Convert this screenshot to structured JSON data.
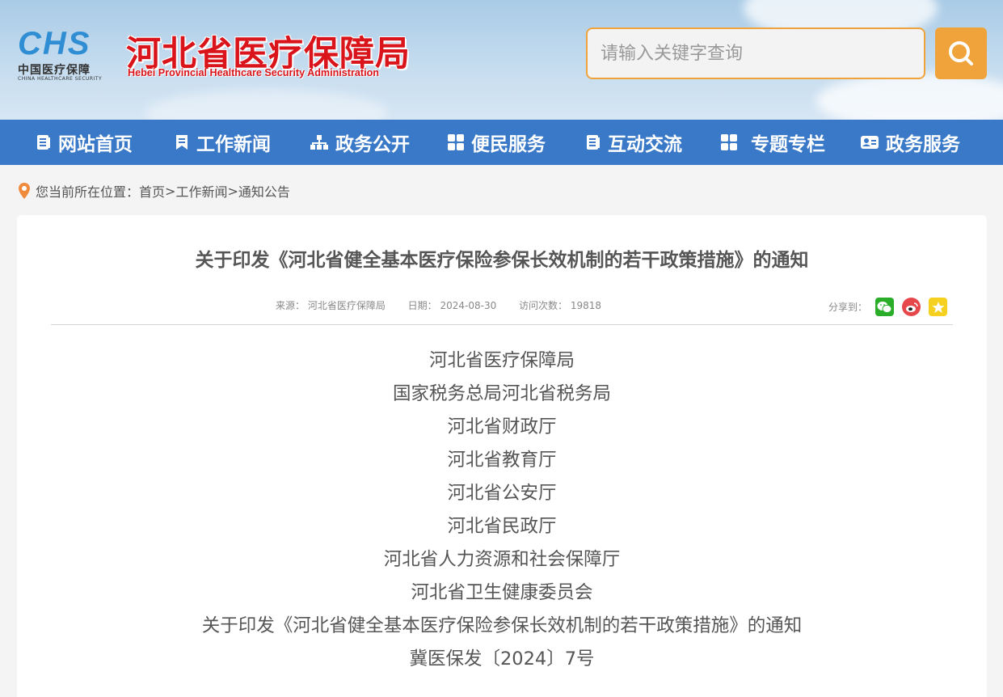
{
  "header": {
    "logo_mark": "CHS",
    "logo_text": "中国医疗保障",
    "logo_text_en": "CHINA HEALTHCARE SECURITY",
    "site_title": "河北省医疗保障局",
    "site_title_en": "Hebei Provincial Healthcare Security Administration",
    "search_placeholder": "请输入关键字查询"
  },
  "nav": {
    "items": [
      {
        "label": "网站首页",
        "icon": "document-list-icon"
      },
      {
        "label": "工作新闻",
        "icon": "bookmark-icon"
      },
      {
        "label": "政务公开",
        "icon": "org-chart-icon"
      },
      {
        "label": "便民服务",
        "icon": "grid-icon"
      },
      {
        "label": "互动交流",
        "icon": "document-list-icon"
      },
      {
        "label": "专题专栏",
        "icon": "grid-icon"
      },
      {
        "label": "政务服务",
        "icon": "id-card-icon"
      }
    ]
  },
  "breadcrumb": {
    "prefix": "您当前所在位置：",
    "items": [
      "首页",
      "工作新闻",
      "通知公告"
    ],
    "separator": ">"
  },
  "article": {
    "title": "关于印发《河北省健全基本医疗保险参保长效机制的若干政策措施》的通知",
    "source": "来源：  河北省医疗保障局",
    "date": "日期：  2024-08-30",
    "visits": "访问次数：  19818",
    "share_label": "分享到：",
    "body_lines": [
      "河北省医疗保障局",
      "国家税务总局河北省税务局",
      "河北省财政厅",
      "河北省教育厅",
      "河北省公安厅",
      "河北省民政厅",
      "河北省人力资源和社会保障厅",
      "河北省卫生健康委员会",
      "关于印发《河北省健全基本医疗保险参保长效机制的若干政策措施》的通知",
      "冀医保发〔2024〕7号"
    ]
  },
  "colors": {
    "nav_bg": "#3a79c8",
    "accent_orange": "#f0a33b",
    "title_red": "#d9141b",
    "logo_blue": "#2f8ed3",
    "wechat_green": "#2aae2a",
    "weibo_red": "#e6474b",
    "favorite_yellow": "#f5d01e"
  }
}
